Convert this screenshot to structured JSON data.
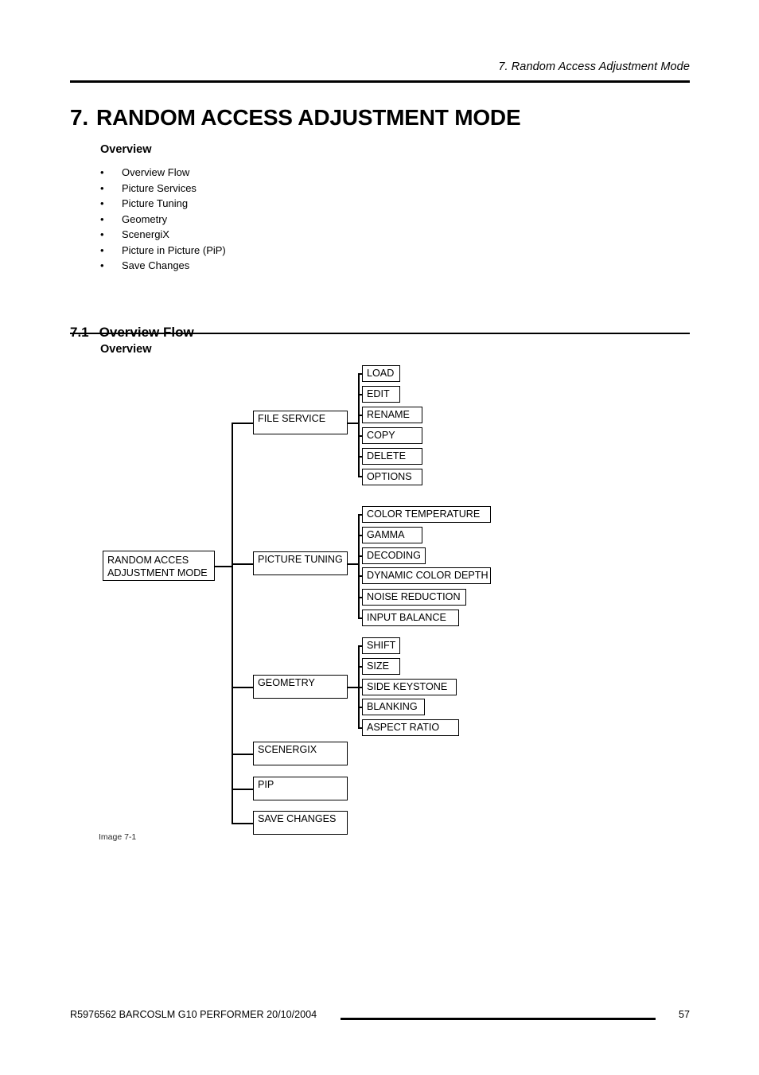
{
  "running_head": "7.  Random Access Adjustment Mode",
  "chapter": {
    "number": "7.",
    "title": "RANDOM ACCESS ADJUSTMENT MODE"
  },
  "overview": {
    "heading": "Overview",
    "bullet": "•",
    "items": [
      "Overview Flow",
      "Picture Services",
      "Picture Tuning",
      "Geometry",
      "ScenergiX",
      "Picture in Picture (PiP)",
      "Save Changes"
    ]
  },
  "section": {
    "number": "7.1",
    "title": "Overview Flow",
    "subheading": "Overview"
  },
  "diagram": {
    "caption": "Image 7-1",
    "root": {
      "line1": "RANDOM ACCES",
      "line2": "ADJUSTMENT MODE"
    },
    "branches": [
      {
        "label": "FILE SERVICE",
        "children": [
          "LOAD",
          "EDIT",
          "RENAME",
          "COPY",
          "DELETE",
          "OPTIONS"
        ]
      },
      {
        "label": "PICTURE TUNING",
        "children": [
          "COLOR TEMPERATURE",
          "GAMMA",
          "DECODING",
          "DYNAMIC COLOR DEPTH",
          "NOISE REDUCTION",
          "INPUT BALANCE"
        ]
      },
      {
        "label": "GEOMETRY",
        "children": [
          "SHIFT",
          "SIZE",
          "SIDE KEYSTONE",
          "BLANKING",
          "ASPECT RATIO"
        ]
      },
      {
        "label": "SCENERGIX",
        "children": []
      },
      {
        "label": "PIP",
        "children": []
      },
      {
        "label": "SAVE CHANGES",
        "children": []
      }
    ]
  },
  "footer": {
    "document_id": "R5976562",
    "product": "BARCOSLM G10 PERFORMER",
    "date": "20/10/2004",
    "text": "R5976562   BARCOSLM G10 PERFORMER  20/10/2004",
    "page": "57"
  }
}
